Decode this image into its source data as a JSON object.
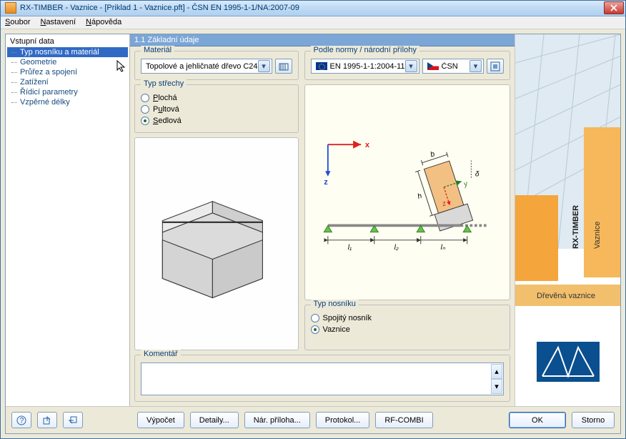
{
  "window": {
    "title": "RX-TIMBER - Vaznice - [Priklad 1 - Vaznice.pft] - ČSN EN 1995-1-1/NA:2007-09"
  },
  "menu": {
    "file": "Soubor",
    "settings": "Nastavení",
    "help": "Nápověda"
  },
  "tree": {
    "root": "Vstupní data",
    "items": [
      "Typ nosníku a materiál",
      "Geometrie",
      "Průřez a spojení",
      "Zatížení",
      "Řídicí parametry",
      "Vzpěrné délky"
    ],
    "selected_index": 0
  },
  "section_title": "1.1 Základní údaje",
  "material": {
    "legend": "Materiál",
    "value": "Topolové a jehličnaté dřevo C24"
  },
  "standard": {
    "legend": "Podle normy / národní přílohy",
    "norm": "EN 1995-1-1:2004-11",
    "annex": "ČSN"
  },
  "roof": {
    "legend": "Typ střechy",
    "options": [
      "Plochá",
      "Pultová",
      "Sedlová"
    ],
    "selected_index": 2
  },
  "beam": {
    "legend": "Typ nosníku",
    "options": [
      "Spojitý nosník",
      "Vaznice"
    ],
    "selected_index": 1
  },
  "diagram": {
    "axis_x": "x",
    "axis_z": "z",
    "dim_b": "b",
    "dim_h": "h",
    "dim_y": "y",
    "dim_z": "z",
    "dim_delta": "δ",
    "span_l1": "l₁",
    "span_l2": "l₂",
    "span_ln": "lₙ"
  },
  "comment": {
    "legend": "Komentář",
    "value": ""
  },
  "sidebox": {
    "product": "RX-TIMBER",
    "subtitle": "Vaznice",
    "caption": "Dřevěná vaznice"
  },
  "buttons": {
    "calculate": "Výpočet",
    "details": "Detaily...",
    "annex": "Nár. příloha...",
    "protocol": "Protokol...",
    "rfcombi": "RF-COMBI",
    "ok": "OK",
    "cancel": "Storno"
  }
}
